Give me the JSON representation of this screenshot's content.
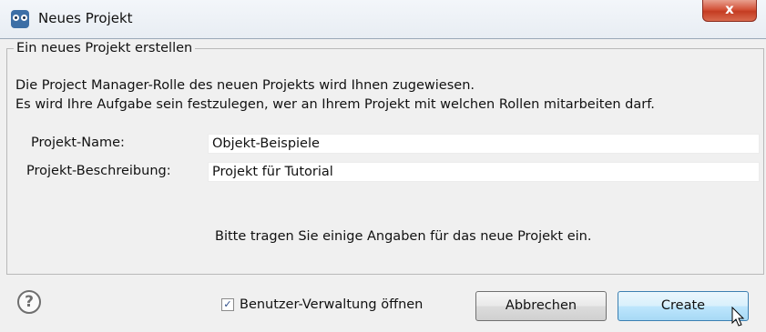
{
  "window": {
    "title": "Neues Projekt",
    "close_label": "x",
    "icon": "owl-app-icon"
  },
  "group": {
    "title": "Ein neues Projekt erstellen",
    "description_line1": "Die Project Manager-Rolle des neuen Projekts wird Ihnen zugewiesen.",
    "description_line2": "Es wird Ihre Aufgabe sein festzulegen, wer an Ihrem Projekt mit welchen Rollen mitarbeiten darf.",
    "name_label": "Projekt-Name:",
    "name_value": "Objekt-Beispiele",
    "description_label": "Projekt-Beschreibung:",
    "description_value": "Projekt für Tutorial",
    "hint": "Bitte tragen Sie einige Angaben für das neue Projekt ein."
  },
  "footer": {
    "help_icon": "?",
    "checkbox_checked": true,
    "checkbox_mark": "✓",
    "checkbox_label": "Benutzer-Verwaltung öffnen",
    "cancel_label": "Abbrechen",
    "create_label": "Create"
  }
}
